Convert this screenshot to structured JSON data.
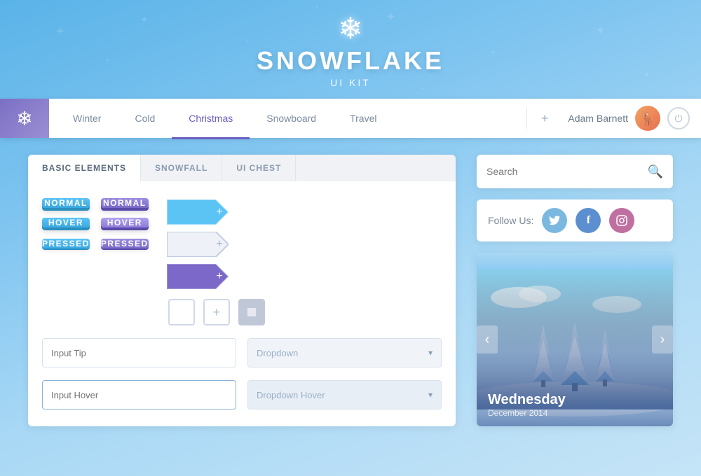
{
  "header": {
    "title": "SNOWFLAKE",
    "subtitle": "UI KIT",
    "snowflake_icon": "❄"
  },
  "navbar": {
    "logo_icon": "❄",
    "nav_items": [
      {
        "label": "Winter",
        "active": false
      },
      {
        "label": "Cold",
        "active": false
      },
      {
        "label": "Christmas",
        "active": true
      },
      {
        "label": "Snowboard",
        "active": false
      },
      {
        "label": "Travel",
        "active": false
      }
    ],
    "add_icon": "+",
    "username": "Adam Barnett",
    "power_icon": "⏻"
  },
  "left_panel": {
    "tabs": [
      {
        "label": "BASIC ELEMENTS",
        "active": true
      },
      {
        "label": "SNOWFALL",
        "active": false
      },
      {
        "label": "UI CHEST",
        "active": false
      }
    ],
    "blue_buttons": [
      {
        "label": "NORMAL"
      },
      {
        "label": "HOVER"
      },
      {
        "label": "PRESSED"
      }
    ],
    "purple_buttons": [
      {
        "label": "NORMAL"
      },
      {
        "label": "HOVER"
      },
      {
        "label": "PRESSED"
      }
    ],
    "input_tip_placeholder": "Input Tip",
    "input_hover_placeholder": "Input Hover",
    "dropdown_label": "Dropdown",
    "dropdown_hover_label": "Dropdown Hover"
  },
  "right_panel": {
    "search_placeholder": "Search",
    "search_icon": "🔍",
    "follow_label": "Follow Us:",
    "social_icons": [
      {
        "name": "twitter",
        "icon": "🐦"
      },
      {
        "name": "facebook",
        "icon": "f"
      },
      {
        "name": "instagram",
        "icon": "📷"
      }
    ],
    "image_card": {
      "day": "Wednesday",
      "date": "December 2014"
    }
  }
}
